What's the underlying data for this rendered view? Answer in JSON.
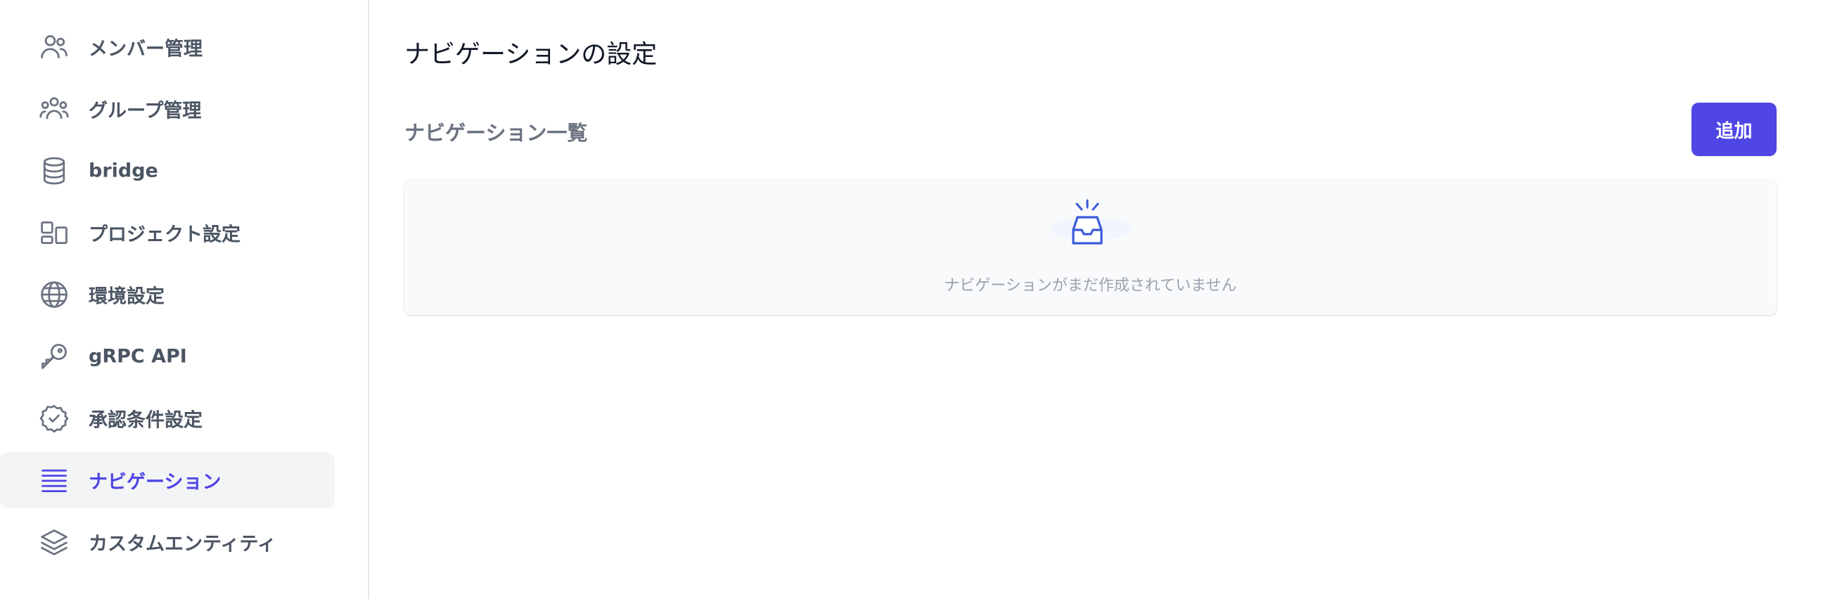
{
  "sidebar": {
    "items": [
      {
        "label": "メンバー管理",
        "icon": "users-icon",
        "active": false
      },
      {
        "label": "グループ管理",
        "icon": "user-group-icon",
        "active": false
      },
      {
        "label": "bridge",
        "icon": "database-icon",
        "active": false
      },
      {
        "label": "プロジェクト設定",
        "icon": "layout-icon",
        "active": false
      },
      {
        "label": "環境設定",
        "icon": "globe-icon",
        "active": false
      },
      {
        "label": "gRPC API",
        "icon": "key-icon",
        "active": false
      },
      {
        "label": "承認条件設定",
        "icon": "badge-check-icon",
        "active": false
      },
      {
        "label": "ナビゲーション",
        "icon": "menu-lines-icon",
        "active": true
      },
      {
        "label": "カスタムエンティティ",
        "icon": "layers-icon",
        "active": false
      }
    ]
  },
  "main": {
    "page_title": "ナビゲーションの設定",
    "section_title": "ナビゲーション一覧",
    "add_button_label": "追加",
    "empty_state": {
      "icon": "inbox-icon",
      "message": "ナビゲーションがまだ作成されていません"
    }
  },
  "colors": {
    "accent": "#4f46e5",
    "sidebar_text": "#4b5563",
    "muted_text": "#9ca3af",
    "active_bg": "#f3f4f6",
    "empty_icon": "#3b5bdb"
  }
}
